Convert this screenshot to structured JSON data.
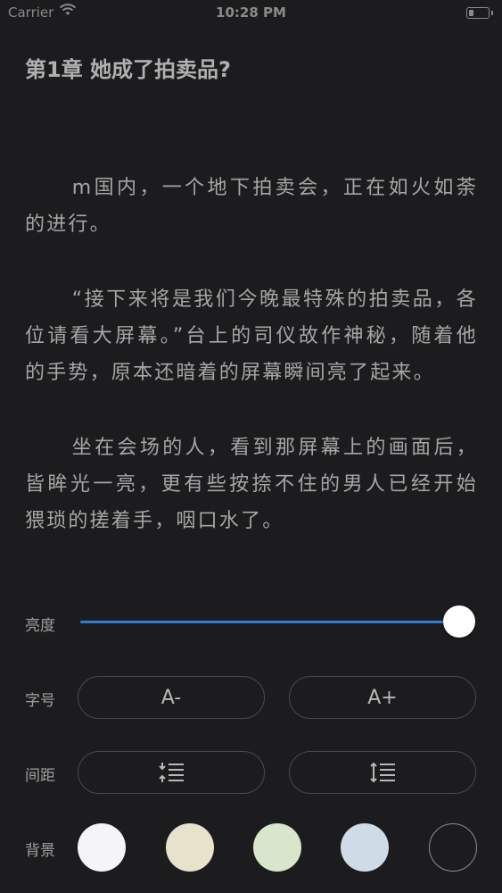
{
  "status_bar": {
    "carrier": "Carrier",
    "time": "10:28 PM"
  },
  "chapter": {
    "title": "第1章 她成了拍卖品?",
    "paragraphs": [
      "m国内，一个地下拍卖会，正在如火如荼的进行。",
      "“接下来将是我们今晚最特殊的拍卖品，各位请看大屏幕。”台上的司仪故作神秘，随着他的手势，原本还暗着的屏幕瞬间亮了起来。",
      "坐在会场的人，看到那屏幕上的画面后，皆眸光一亮，更有些按捺不住的男人已经开始猥琐的搓着手，咽口水了。"
    ]
  },
  "settings": {
    "brightness": {
      "label": "亮度",
      "value": 1.0,
      "track_color": "#2f7bd8"
    },
    "font_size": {
      "label": "字号",
      "decrease": "A-",
      "increase": "A+"
    },
    "spacing": {
      "label": "间距",
      "decrease_icon": "line-spacing-decrease-icon",
      "increase_icon": "line-spacing-increase-icon"
    },
    "background": {
      "label": "背景",
      "colors": [
        "#f5f5f7",
        "#e6e2cc",
        "#d7e6cc",
        "#cfdce8",
        "#1c1c1e"
      ],
      "selected": 4
    }
  }
}
